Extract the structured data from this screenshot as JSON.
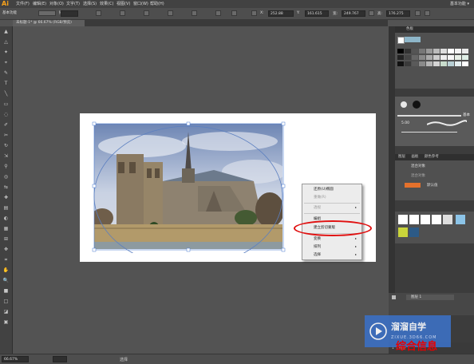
{
  "app": {
    "logo": "Ai",
    "right_label": "基本功能 ▾"
  },
  "menu": [
    "文件(F)",
    "编辑(E)",
    "对象(O)",
    "文字(T)",
    "选择(S)",
    "效果(C)",
    "视图(V)",
    "窗口(W)",
    "帮助(H)"
  ],
  "control_bar": {
    "mode_label": "基本功能",
    "stroke_label": "描边",
    "x_label": "X:",
    "x_value": "252.88",
    "y_label": "Y:",
    "y_value": "161.615",
    "w_label": "宽:",
    "w_value": "249.767",
    "h_label": "高:",
    "h_value": "176.275"
  },
  "document": {
    "tab_label": "未标题-1* @ 66.67% (RGB/预览)"
  },
  "context_menu": {
    "items": [
      {
        "label": "还原(U)椭圆",
        "dim": false,
        "arrow": false
      },
      {
        "label": "重做(R)",
        "dim": true,
        "arrow": false
      },
      {
        "label": "透视",
        "dim": true,
        "arrow": true
      },
      {
        "label": "编组",
        "dim": false,
        "arrow": false
      },
      {
        "label": "建立剪切蒙版",
        "dim": false,
        "arrow": false,
        "highlight": true
      },
      {
        "label": "变换",
        "dim": false,
        "arrow": true
      },
      {
        "label": "排列",
        "dim": false,
        "arrow": true
      },
      {
        "label": "选择",
        "dim": false,
        "arrow": true
      }
    ]
  },
  "panels": {
    "swatches_tab": "色板",
    "brushes_label": "基本",
    "brush_size": "5.00",
    "layers_tabs": [
      "图层",
      "画板",
      "颜色参考"
    ],
    "layer_rows": [
      "混合对象",
      "混合对象",
      "默认值"
    ],
    "layer_name": "图层 1",
    "layers_count": "1 个图层"
  },
  "status": {
    "zoom": "66.67%",
    "tool": "选择"
  },
  "watermark": {
    "title": "溜溜自学",
    "subtitle": "ZIXUE.3D66.COM",
    "red_text": "综合信息"
  },
  "colors": {
    "accent": "#e4712c",
    "highlight_ring": "#e01010",
    "watermark_blue": "#3c6fc1"
  }
}
